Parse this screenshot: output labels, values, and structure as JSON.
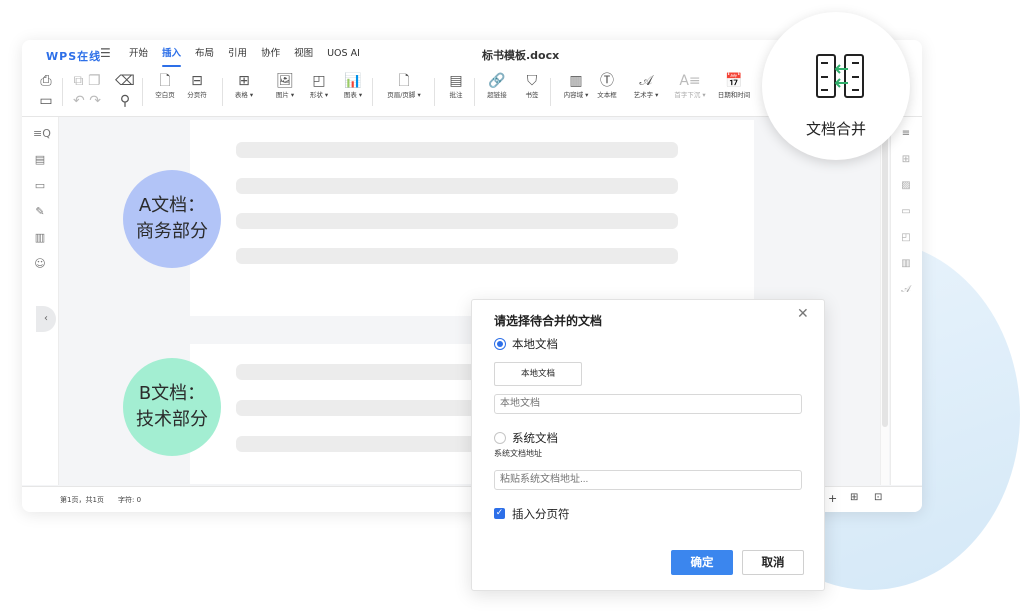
{
  "brand": "WPS在线",
  "menu": [
    "开始",
    "插入",
    "布局",
    "引用",
    "协作",
    "视图",
    "UOS AI"
  ],
  "active_menu": "插入",
  "document_title": "标书模板.docx",
  "toolbar": [
    {
      "label": "空白页",
      "icon": "blank-page-icon",
      "glyph": "🗋"
    },
    {
      "label": "分页符",
      "icon": "page-break-icon",
      "glyph": "⊟"
    },
    {
      "label": "表格 ▾",
      "icon": "table-icon",
      "glyph": "⊞"
    },
    {
      "label": "图片 ▾",
      "icon": "image-icon",
      "glyph": "🖼"
    },
    {
      "label": "形状 ▾",
      "icon": "shape-icon",
      "glyph": "◰"
    },
    {
      "label": "图表 ▾",
      "icon": "chart-icon",
      "glyph": "📊"
    },
    {
      "label": "页眉/页脚 ▾",
      "icon": "header-footer-icon",
      "glyph": "🗋"
    },
    {
      "label": "批注",
      "icon": "comment-icon",
      "glyph": "▤"
    },
    {
      "label": "超链接",
      "icon": "link-icon",
      "glyph": "🔗"
    },
    {
      "label": "书签",
      "icon": "bookmark-icon",
      "glyph": "⛉"
    },
    {
      "label": "内容域 ▾",
      "icon": "content-field-icon",
      "glyph": "▥"
    },
    {
      "label": "文本框",
      "icon": "textbox-icon",
      "glyph": "Ⓣ"
    },
    {
      "label": "艺术字 ▾",
      "icon": "wordart-icon",
      "glyph": "𝒜"
    },
    {
      "label": "首字下沉 ▾",
      "icon": "drop-cap-icon",
      "glyph": "A≡"
    },
    {
      "label": "日期和时间",
      "icon": "date-time-icon",
      "glyph": "📅"
    }
  ],
  "bubble_a": {
    "line1": "A文档：",
    "line2": "商务部分"
  },
  "bubble_b": {
    "line1": "B文档：",
    "line2": "技术部分"
  },
  "feature": {
    "label": "文档合并",
    "icon": "document-merge-icon"
  },
  "status": {
    "page": "第1页，共1页",
    "words": "字符: 0"
  },
  "dialog": {
    "title": "请选择待合并的文档",
    "option_local": "本地文档",
    "button_local": "本地文档",
    "input_local_placeholder": "本地文档",
    "option_system": "系统文档",
    "system_address_label": "系统文档地址",
    "input_system_placeholder": "粘贴系统文档地址...",
    "checkbox_label": "插入分页符",
    "checkbox_checked": true,
    "selected_option": "本地文档",
    "ok": "确定",
    "cancel": "取消"
  },
  "colors": {
    "accent": "#2d6fe8",
    "bubble_a": "#b2c4f7",
    "bubble_b": "#a3eed2"
  }
}
